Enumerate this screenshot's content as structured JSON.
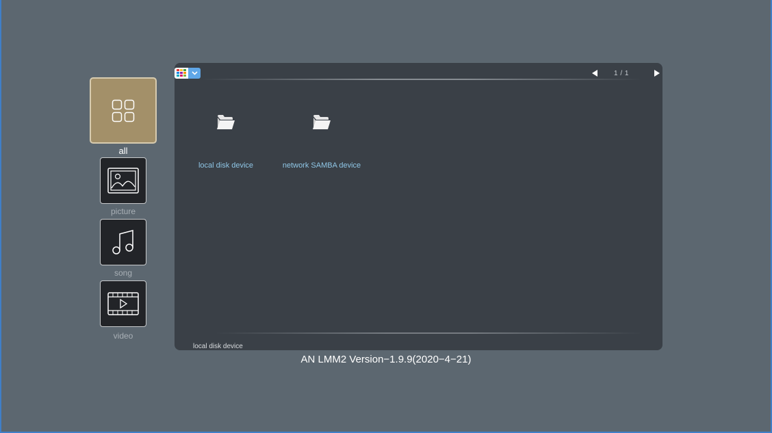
{
  "sidebar": {
    "items": [
      {
        "label": "all",
        "icon": "grid-icon",
        "selected": true
      },
      {
        "label": "picture",
        "icon": "picture-icon",
        "selected": false
      },
      {
        "label": "song",
        "icon": "music-note-icon",
        "selected": false
      },
      {
        "label": "video",
        "icon": "film-icon",
        "selected": false
      }
    ]
  },
  "toolbar": {
    "view_icon": "grid-view-icon",
    "dropdown_icon": "chevron-down-icon",
    "page_indicator": "1 / 1"
  },
  "files": [
    {
      "name": "local disk device",
      "icon": "folder-icon"
    },
    {
      "name": "network SAMBA device",
      "icon": "folder-icon"
    }
  ],
  "status": {
    "path": "local disk device"
  },
  "footer": {
    "version": "AN LMM2 Version−1.9.9(2020−4−21)"
  },
  "colors": {
    "background": "#5c6770",
    "panel": "#3a4047",
    "selected_tile": "#a39069",
    "file_label": "#8fc6e6",
    "accent_blue": "#5fa7e8"
  }
}
